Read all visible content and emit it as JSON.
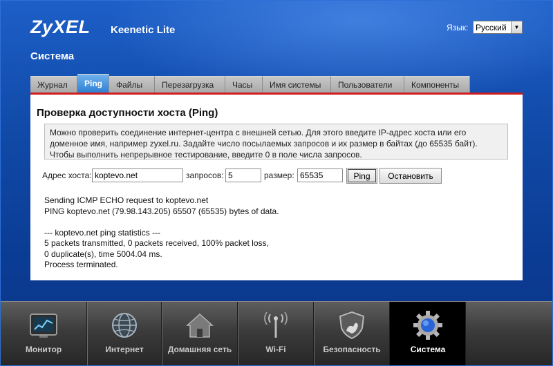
{
  "brand": {
    "logo": "ZyXEL",
    "model": "Keenetic Lite"
  },
  "language": {
    "label": "Язык:",
    "selected": "Русский"
  },
  "section_title": "Система",
  "tabs": [
    {
      "label": "Журнал"
    },
    {
      "label": "Ping",
      "active": true
    },
    {
      "label": "Файлы"
    },
    {
      "label": "Перезагрузка"
    },
    {
      "label": "Часы"
    },
    {
      "label": "Имя системы"
    },
    {
      "label": "Пользователи"
    },
    {
      "label": "Компоненты"
    }
  ],
  "panel": {
    "title": "Проверка доступности хоста (Ping)",
    "info_lines": [
      "Можно проверить соединение интернет-центра с внешней сетью. Для этого введите IP-адрес хоста или его",
      "доменное имя, например zyxel.ru. Задайте число посылаемых запросов и их размер в байтах (до 65535 байт).",
      "Чтобы выполнить непрерывное тестирование, введите 0 в поле числа запросов."
    ],
    "host_label": "Адрес хоста:",
    "host_value": "koptevo.net",
    "count_label": "запросов:",
    "count_value": "5",
    "size_label": "размер:",
    "size_value": "65535",
    "ping_button": "Ping",
    "stop_button": "Остановить",
    "output_lines": [
      "Sending ICMP ECHO request to koptevo.net",
      "PING koptevo.net (79.98.143.205) 65507 (65535) bytes of data.",
      "",
      "--- koptevo.net ping statistics ---",
      "5 packets transmitted, 0 packets received, 100% packet loss,",
      "0 duplicate(s), time 5004.04 ms.",
      "Process terminated."
    ]
  },
  "dock": [
    {
      "label": "Монитор",
      "icon": "monitor-icon"
    },
    {
      "label": "Интернет",
      "icon": "globe-icon"
    },
    {
      "label": "Домашняя сеть",
      "icon": "home-icon"
    },
    {
      "label": "Wi-Fi",
      "icon": "wifi-antenna-icon"
    },
    {
      "label": "Безопасность",
      "icon": "shield-icon"
    },
    {
      "label": "Система",
      "icon": "gear-icon",
      "active": true
    }
  ],
  "colors": {
    "accent_red": "#d11c1c",
    "tab_active": "#2f7fd2",
    "background": "#114aa8"
  }
}
